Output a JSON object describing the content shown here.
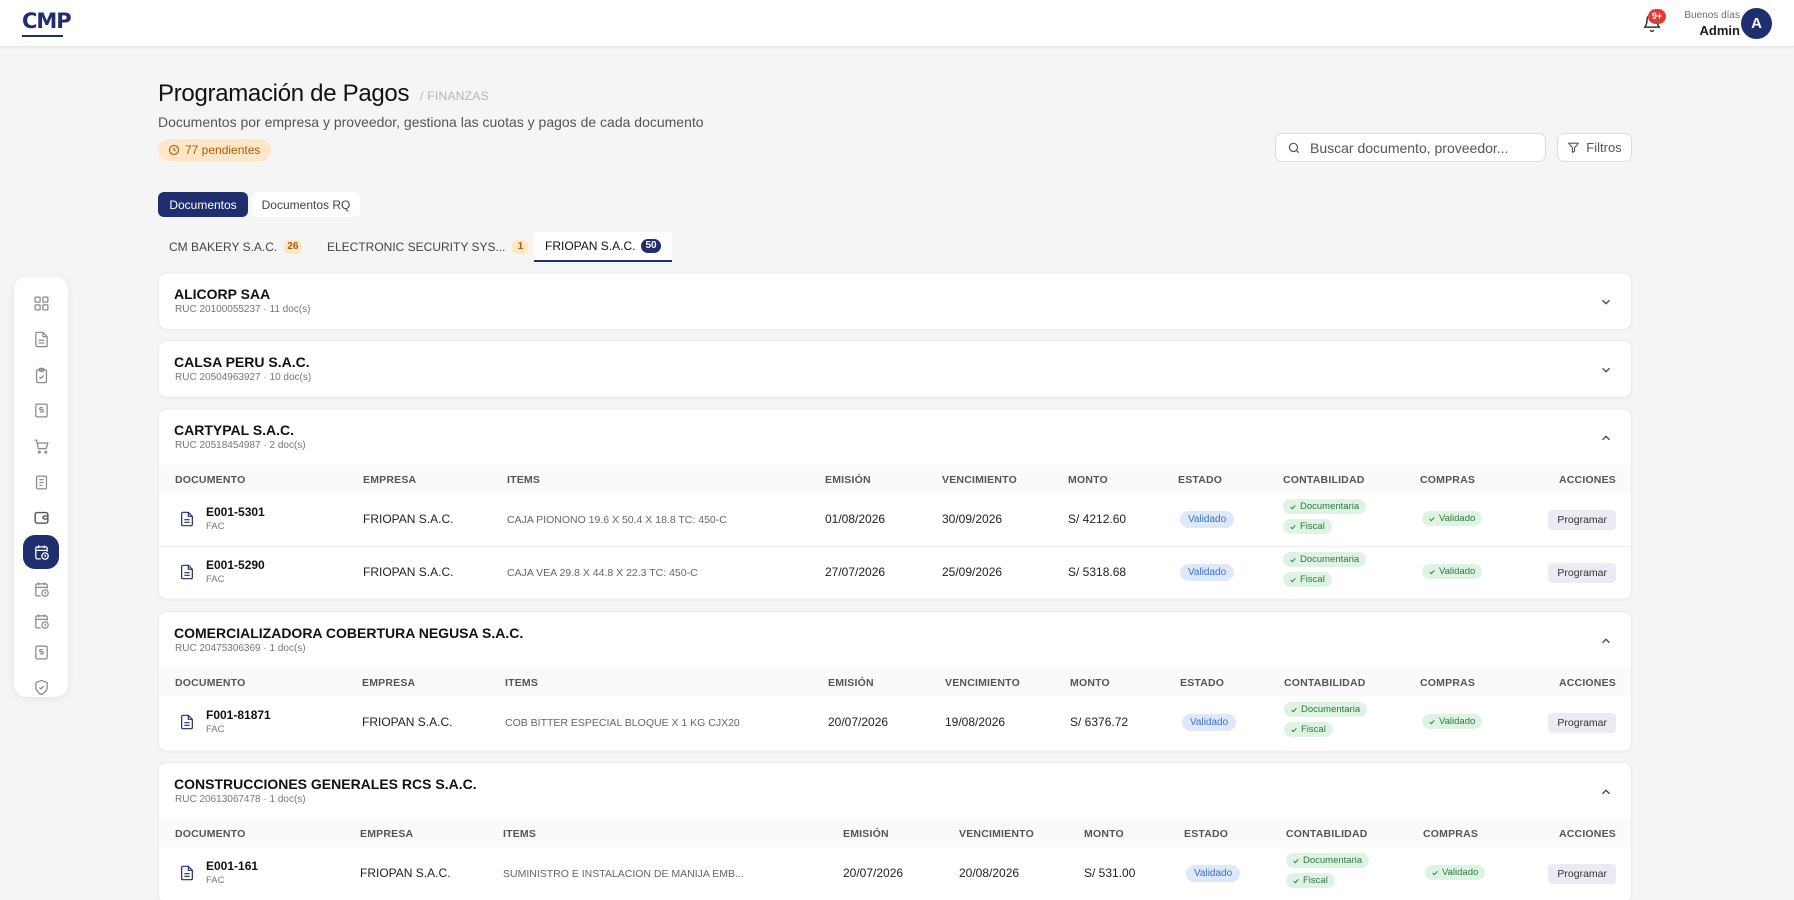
{
  "topbar": {
    "logo": "CMP",
    "notif_badge": "9+",
    "greeting": "Buenos días",
    "user_name": "Admin",
    "avatar_initial": "A"
  },
  "sidebar": {
    "icons": [
      "grid-icon",
      "document-icon",
      "clipboard-check-icon",
      "dollar-doc-icon",
      "cart-icon",
      "notebook-icon",
      "wallet-icon",
      "calendar-clock-icon",
      "calendar-clock-icon",
      "calendar-clock-icon",
      "dollar-doc-icon",
      "shield-check-icon"
    ],
    "active_index": 7
  },
  "header": {
    "title": "Programación de Pagos",
    "crumb": "/ FINANZAS",
    "subtitle": "Documentos por empresa y proveedor, gestiona las cuotas y pagos de cada documento",
    "pending": "77 pendientes",
    "search_placeholder": "Buscar documento, proveedor...",
    "filters_label": "Filtros"
  },
  "tabs": {
    "documentos": "Documentos",
    "documentos_rq": "Documentos RQ"
  },
  "company_tabs": [
    {
      "label": "CM BAKERY S.A.C.",
      "count": "26"
    },
    {
      "label": "ELECTRONIC SECURITY SYS...",
      "count": "1"
    },
    {
      "label": "FRIOPAN S.A.C.",
      "count": "50"
    }
  ],
  "columns": [
    "DOCUMENTO",
    "EMPRESA",
    "ITEMS",
    "EMISIÓN",
    "VENCIMIENTO",
    "MONTO",
    "ESTADO",
    "CONTABILIDAD",
    "COMPRAS",
    "ACCIONES"
  ],
  "labels": {
    "validado": "Validado",
    "documentaria": "Documentaria",
    "fiscal": "Fiscal",
    "programar": "Programar"
  },
  "suppliers": [
    {
      "name": "ALICORP SAA",
      "ruc": "RUC 20100055237 · 11 doc(s)",
      "expanded": false,
      "rows": []
    },
    {
      "name": "CALSA PERU S.A.C.",
      "ruc": "RUC 20504963927 · 10 doc(s)",
      "expanded": false,
      "rows": []
    },
    {
      "name": "CARTYPAL S.A.C.",
      "ruc": "RUC 20518454987 · 2 doc(s)",
      "expanded": true,
      "rows": [
        {
          "doc": "E001-5301",
          "type": "FAC",
          "empresa": "FRIOPAN S.A.C.",
          "items": "CAJA PIONONO 19.6 X 50.4 X 18.8 TC: 450-C",
          "emision": "01/08/2026",
          "vencimiento": "30/09/2026",
          "monto": "S/ 4212.60"
        },
        {
          "doc": "E001-5290",
          "type": "FAC",
          "empresa": "FRIOPAN S.A.C.",
          "items": "CAJA VEA 29.8 X 44.8 X 22.3 TC: 450-C",
          "emision": "27/07/2026",
          "vencimiento": "25/09/2026",
          "monto": "S/ 5318.68"
        }
      ]
    },
    {
      "name": "COMERCIALIZADORA COBERTURA NEGUSA S.A.C.",
      "ruc": "RUC 20475306369 · 1 doc(s)",
      "expanded": true,
      "rows": [
        {
          "doc": "F001-81871",
          "type": "FAC",
          "empresa": "FRIOPAN S.A.C.",
          "items": "COB BITTER ESPECIAL BLOQUE X 1 KG CJX20",
          "emision": "20/07/2026",
          "vencimiento": "19/08/2026",
          "monto": "S/ 6376.72"
        }
      ]
    },
    {
      "name": "CONSTRUCCIONES GENERALES RCS S.A.C.",
      "ruc": "RUC 20613067478 · 1 doc(s)",
      "expanded": true,
      "rows": [
        {
          "doc": "E001-161",
          "type": "FAC",
          "empresa": "FRIOPAN S.A.C.",
          "items": "SUMINISTRO E INSTALACION DE MANIJA EMB...",
          "emision": "20/07/2026",
          "vencimiento": "20/08/2026",
          "monto": "S/ 531.00"
        }
      ]
    }
  ]
}
